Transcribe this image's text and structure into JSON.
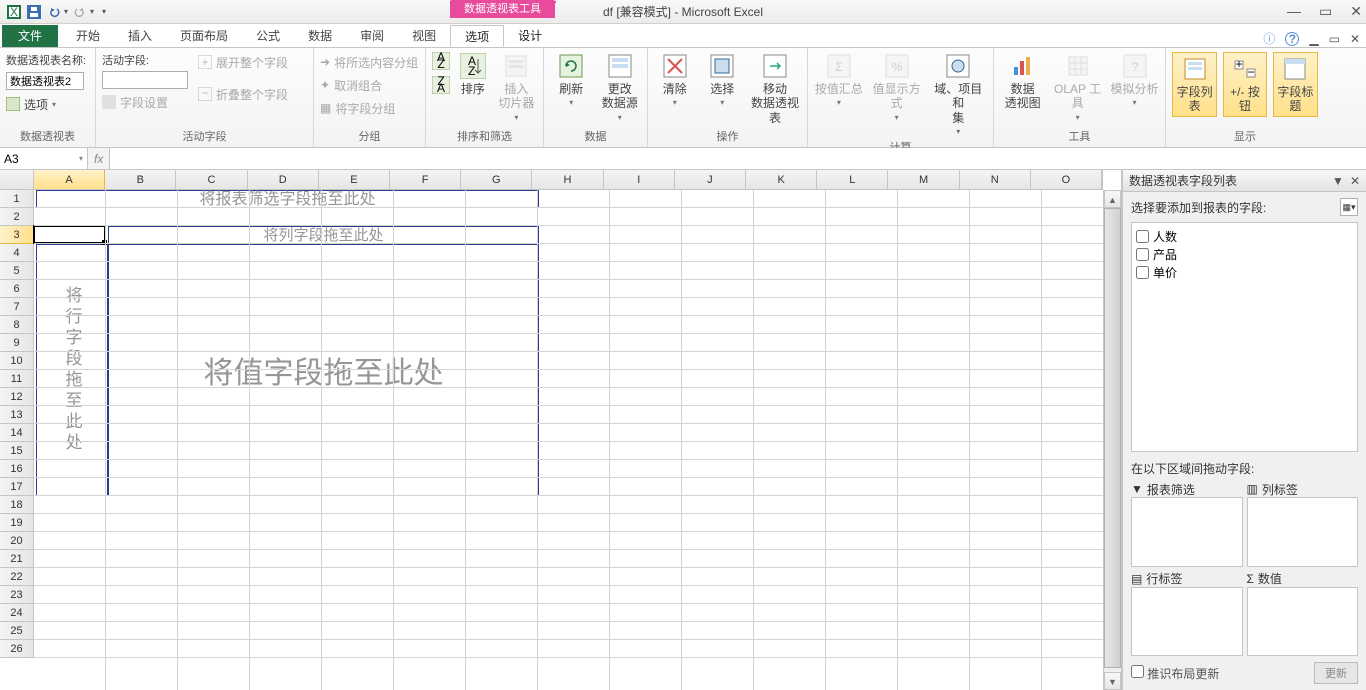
{
  "titlebar": {
    "context_tool_label": "数据透视表工具",
    "title": "df  [兼容模式] - Microsoft Excel",
    "window_buttons": {
      "min": "—",
      "max": "▭",
      "close": "✕"
    }
  },
  "ribbon_tabs": {
    "file": "文件",
    "tabs": [
      "开始",
      "插入",
      "页面布局",
      "公式",
      "数据",
      "审阅",
      "视图"
    ],
    "context_tabs": [
      "选项",
      "设计"
    ],
    "active": "选项",
    "help_icons": {
      "help": "?",
      "minimize_ribbon": "△"
    }
  },
  "ribbon": {
    "group1": {
      "label": "数据透视表",
      "name_label": "数据透视表名称:",
      "name_value": "数据透视表2",
      "options_btn": "选项"
    },
    "group2": {
      "label": "活动字段",
      "active_field_label": "活动字段:",
      "active_field_value": "",
      "field_settings": "字段设置",
      "expand_field": "展开整个字段",
      "collapse_field": "折叠整个字段"
    },
    "group3": {
      "label": "分组",
      "items": [
        "将所选内容分组",
        "取消组合",
        "将字段分组"
      ]
    },
    "group4": {
      "label": "排序和筛选",
      "sort": "排序",
      "slicer": "插入\n切片器"
    },
    "group5": {
      "label": "数据",
      "refresh": "刷新",
      "change": "更改\n数据源"
    },
    "group6": {
      "label": "操作",
      "clear": "清除",
      "select": "选择",
      "move": "移动\n数据透视表"
    },
    "group7": {
      "label": "计算",
      "sumby": "按值汇总",
      "showas": "值显示方式",
      "fields": "域、项目和\n集"
    },
    "group8": {
      "label": "工具",
      "chart": "数据\n透视图",
      "olap": "OLAP 工具",
      "whatif": "模拟分析"
    },
    "group9": {
      "label": "显示",
      "fieldlist": "字段列表",
      "btns": "+/- 按钮",
      "headers": "字段标题"
    }
  },
  "formula_bar": {
    "name_box": "A3",
    "fx": "fx"
  },
  "grid": {
    "columns": [
      "A",
      "B",
      "C",
      "D",
      "E",
      "F",
      "G",
      "H",
      "I",
      "J",
      "K",
      "L",
      "M",
      "N",
      "O"
    ],
    "rows_visible": 26,
    "selected_col": "A",
    "selected_row": 3
  },
  "pivot_overlay": {
    "filter_text": "将报表筛选字段拖至此处",
    "cols_text": "将列字段拖至此处",
    "rows_text": "将行字段拖至此处",
    "values_text": "将值字段拖至此处"
  },
  "field_pane": {
    "title": "数据透视表字段列表",
    "subtitle": "选择要添加到报表的字段:",
    "fields": [
      "人数",
      "产品",
      "单价"
    ],
    "areas_hint": "在以下区域间拖动字段:",
    "area_filter": "报表筛选",
    "area_cols": "列标签",
    "area_rows": "行标签",
    "area_vals": "数值",
    "defer_label": "推识布局更新",
    "update_btn": "更新"
  }
}
